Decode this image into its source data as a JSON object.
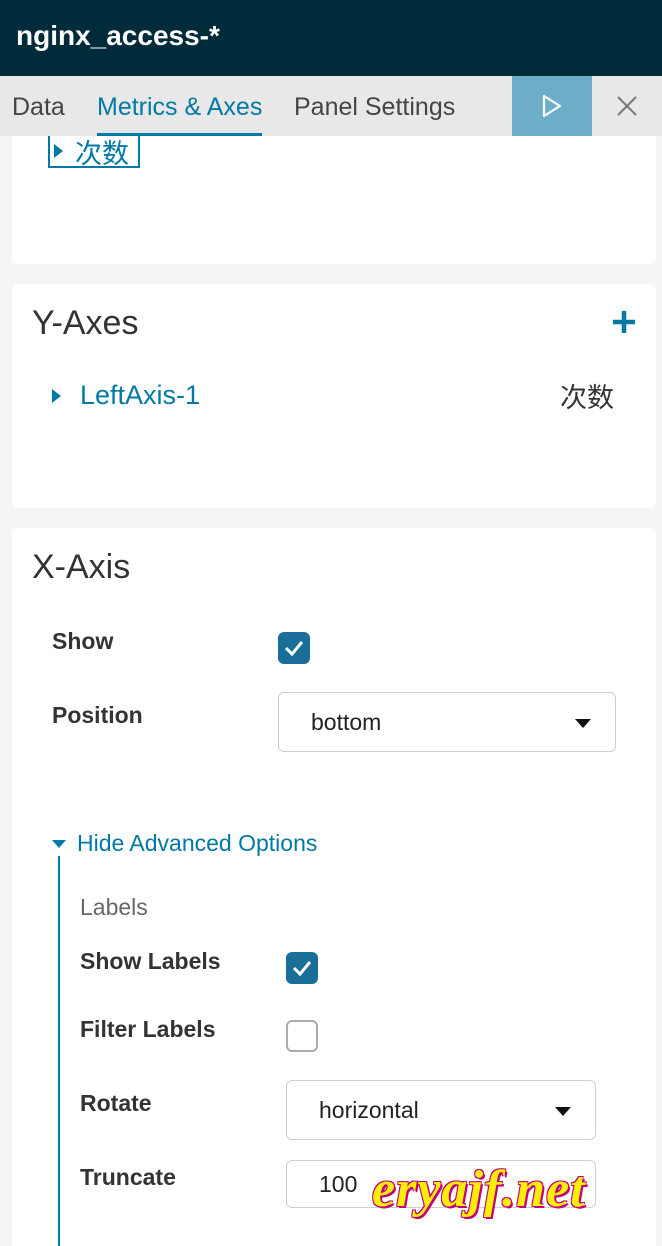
{
  "header": {
    "title": "nginx_access-*"
  },
  "tabs": [
    {
      "label": "Data"
    },
    {
      "label": "Metrics & Axes"
    },
    {
      "label": "Panel Settings"
    }
  ],
  "metrics_card": {
    "metric_label": "次数"
  },
  "y_axes": {
    "title": "Y-Axes",
    "axis_name": "LeftAxis-1",
    "axis_metric": "次数"
  },
  "x_axis": {
    "title": "X-Axis",
    "show_label": "Show",
    "show_checked": true,
    "position_label": "Position",
    "position_value": "bottom",
    "advanced_toggle": "Hide Advanced Options",
    "labels_heading": "Labels",
    "show_labels_label": "Show Labels",
    "show_labels_checked": true,
    "filter_labels_label": "Filter Labels",
    "filter_labels_checked": false,
    "rotate_label": "Rotate",
    "rotate_value": "horizontal",
    "truncate_label": "Truncate",
    "truncate_value": "100"
  },
  "watermark": {
    "text": "eryajf.net"
  },
  "colors": {
    "accent": "#0079a5",
    "header_bg": "#002b3b",
    "run_button": "#6eadc8",
    "checkbox": "#1a6f98"
  }
}
